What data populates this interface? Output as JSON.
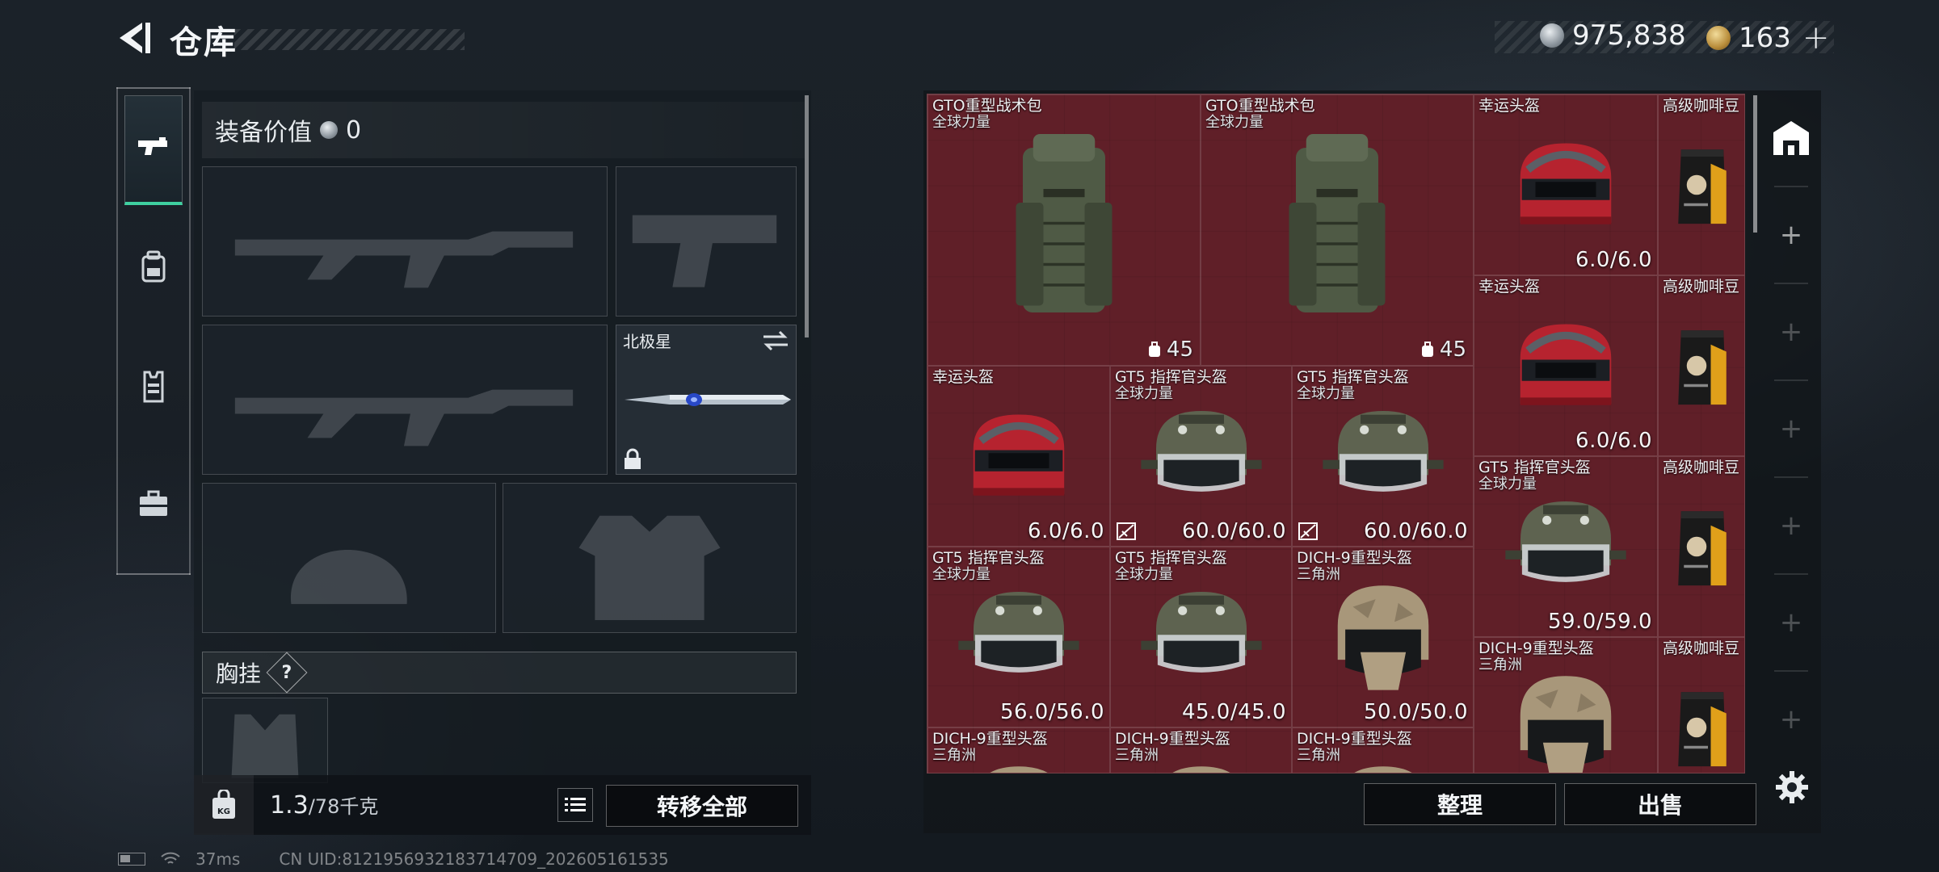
{
  "header": {
    "title": "仓库",
    "currency": {
      "silver": "975,838",
      "gold": "163",
      "plus": "+"
    }
  },
  "sidebar": {
    "tabs": [
      {
        "icon": "pistol-icon",
        "active": true
      },
      {
        "icon": "backpack-icon",
        "active": false
      },
      {
        "icon": "vest-icon",
        "active": false
      },
      {
        "icon": "toolbox-icon",
        "active": false
      }
    ]
  },
  "equipment": {
    "value_label": "装备价值",
    "value": "0",
    "melee_slot_label": "北极星",
    "chest_rig_label": "胸挂",
    "help": "?",
    "weight_current": "1.3",
    "weight_max": "/78千克",
    "transfer_all": "转移全部"
  },
  "inventory": {
    "items": [
      {
        "name": "GTO重型战术包",
        "sub": "全球力量",
        "type": "backpack",
        "cap": "45"
      },
      {
        "name": "GTO重型战术包",
        "sub": "全球力量",
        "type": "backpack",
        "cap": "45"
      },
      {
        "name": "幸运头盔",
        "sub": "",
        "type": "lucky",
        "dur": "6.0/6.0"
      },
      {
        "name": "高级咖啡豆",
        "sub": "",
        "type": "coffee"
      },
      {
        "name": "幸运头盔",
        "sub": "",
        "type": "lucky",
        "dur": "6.0/6.0"
      },
      {
        "name": "高级咖啡豆",
        "sub": "",
        "type": "coffee"
      },
      {
        "name": "幸运头盔",
        "sub": "",
        "type": "lucky",
        "dur": "6.0/6.0"
      },
      {
        "name": "GT5 指挥官头盔",
        "sub": "全球力量",
        "type": "gt5",
        "dur": "60.0/60.0",
        "broken": true
      },
      {
        "name": "GT5 指挥官头盔",
        "sub": "全球力量",
        "type": "gt5",
        "dur": "60.0/60.0",
        "broken": true
      },
      {
        "name": "GT5 指挥官头盔",
        "sub": "全球力量",
        "type": "gt5",
        "dur": "59.0/59.0"
      },
      {
        "name": "高级咖啡豆",
        "sub": "",
        "type": "coffee"
      },
      {
        "name": "GT5 指挥官头盔",
        "sub": "全球力量",
        "type": "gt5",
        "dur": "56.0/56.0"
      },
      {
        "name": "GT5 指挥官头盔",
        "sub": "全球力量",
        "type": "gt5",
        "dur": "45.0/45.0"
      },
      {
        "name": "DICH-9重型头盔",
        "sub": "三角洲",
        "type": "dich",
        "dur": "50.0/50.0"
      },
      {
        "name": "DICH-9重型头盔",
        "sub": "三角洲",
        "type": "dich"
      },
      {
        "name": "高级咖啡豆",
        "sub": "",
        "type": "coffee"
      },
      {
        "name": "DICH-9重型头盔",
        "sub": "三角洲",
        "type": "dich"
      },
      {
        "name": "DICH-9重型头盔",
        "sub": "三角洲",
        "type": "dich"
      },
      {
        "name": "DICH-9重型头盔",
        "sub": "三角洲",
        "type": "dich"
      }
    ],
    "sort_label": "整理",
    "sell_label": "出售"
  },
  "right_tabs": [
    "warehouse-icon",
    "+",
    "+",
    "+",
    "+",
    "+",
    "+",
    "+"
  ],
  "status": {
    "ping": "37ms",
    "uid": "CN UID:8121956932183714709_202605161535"
  },
  "colors": {
    "accent": "#3fd0a0",
    "grid_bg": "#5c1e27"
  }
}
